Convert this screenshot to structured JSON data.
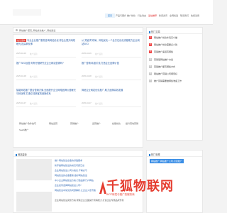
{
  "nav": {
    "items": [
      "首页",
      "产品与服务",
      "推广优化",
      "行业动态",
      "爱站推荐",
      "新闻资讯",
      "全网优选",
      "联系我们",
      "免费试用"
    ],
    "active_index": 0,
    "highlight_index": 4
  },
  "breadcrumb": {
    "text": "网站推广首页_网站优化推广_网站建设"
  },
  "posts": [
    {
      "badge": "最近更新",
      "title": "专业企业推广服务咨询网站优化,帮企业提升网络曝光,提高转化率",
      "date": "2025-04-09",
      "tag": "推广运营"
    },
    {
      "badge": "",
      "title": "从“关键词”布局、网站优化一个全方位优化流程助力企业网站SEO",
      "date": "2025-04-09",
      "tag": "推广运营"
    },
    {
      "badge": "",
      "title": "推广SEO运营,你有仔细研究过企业网站营销吗?",
      "date": "2025-04-08",
      "tag": "推广运营"
    },
    {
      "badge": "",
      "title": "推广营销:精准引流,打造企业品牌价值",
      "date": "2025-04-08",
      "tag": "推广运营"
    },
    {
      "badge": "",
      "title": "智能网站推广整合营销方案,全面提升企业网络品牌价值曝光与转化率,打造引流获客的营销体系",
      "date": "2025-04-07",
      "tag": "推广运营"
    },
    {
      "badge": "",
      "title": "揭秘企业网站优化推广,助力品牌高效发展",
      "date": "2025-04-07",
      "tag": "推广运营"
    }
  ],
  "tags": [
    "网站推广软件技巧",
    "网站运营",
    "营销推广",
    "运营推广",
    "谷歌优化",
    "提升营收营销",
    "SaaS推广"
  ],
  "section": {
    "title": "网站建设",
    "links": [
      "推广网站建设必备的基础要求",
      "新手做网站建设的常见问题汇总",
      "企业网站建设公司价格表,不看必亏",
      "网站建设的必备要素,做好网站建设",
      "中小企业网站建设方案,打造品牌门户网站",
      "企业如何选择网站建设公司?",
      "网站建设中常见的问题解析,让企业少走弯路"
    ],
    "bottom_text": "企业网站建设完整方案,帮助企业全面提升营销能力,打造企业专属品牌形象"
  },
  "sidebar": {
    "title": "热门文章",
    "items": [
      "网站推广优化外包怎么做",
      "网站推广优化需要多少钱",
      "营销推广渠道有哪些",
      "营销型网站推广方案",
      "营销推广都有哪些方式",
      "网站推广营销公司哪家好",
      "推广营销需要做哪些准备工作"
    ]
  },
  "sidebar2": {
    "title": "热门标签",
    "tag": "网站推广,网站推广公司,引流推广"
  },
  "watermark": {
    "big": "千狐物联网",
    "small": "AIOT研发与推广的服务商",
    "color": "#e53d30"
  }
}
